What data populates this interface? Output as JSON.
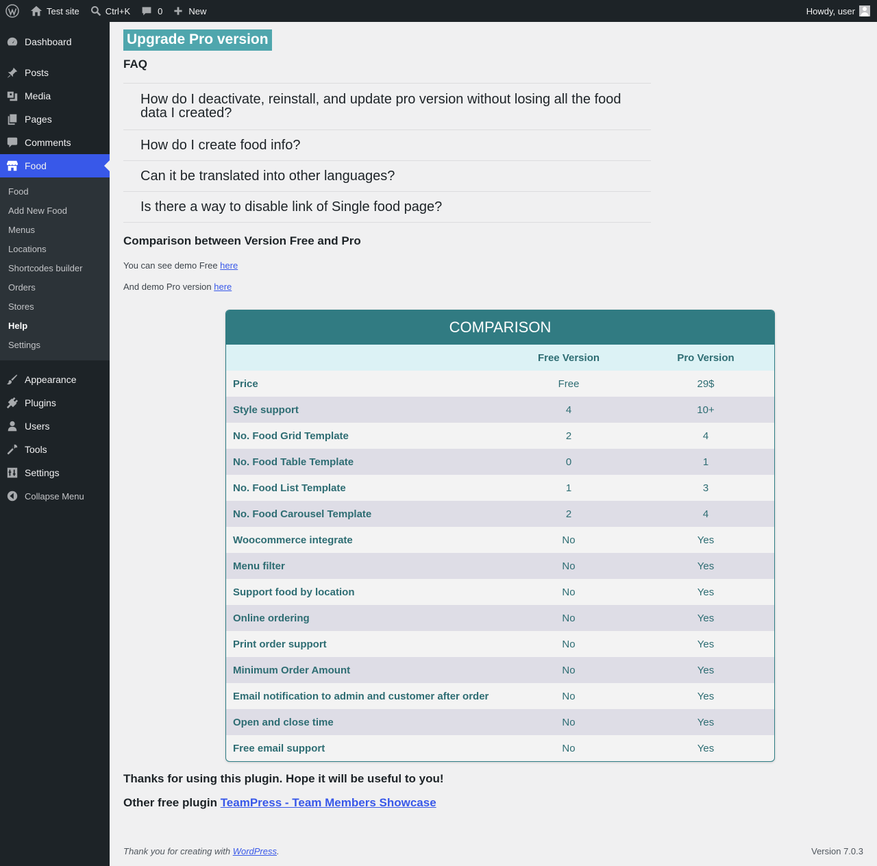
{
  "adminbar": {
    "site_name": "Test site",
    "search_shortcut": "Ctrl+K",
    "comments_count": "0",
    "new_label": "New",
    "howdy": "Howdy, user"
  },
  "sidebar": {
    "items_top": [
      {
        "label": "Dashboard",
        "icon": "dashboard-icon"
      },
      {
        "label": "Posts",
        "icon": "pin-icon"
      },
      {
        "label": "Media",
        "icon": "media-icon"
      },
      {
        "label": "Pages",
        "icon": "pages-icon"
      },
      {
        "label": "Comments",
        "icon": "comment-icon"
      },
      {
        "label": "Food",
        "icon": "store-icon"
      }
    ],
    "submenu": [
      "Food",
      "Add New Food",
      "Menus",
      "Locations",
      "Shortcodes builder",
      "Orders",
      "Stores",
      "Help",
      "Settings"
    ],
    "submenu_active": "Help",
    "items_bottom": [
      {
        "label": "Appearance",
        "icon": "brush-icon"
      },
      {
        "label": "Plugins",
        "icon": "plug-icon"
      },
      {
        "label": "Users",
        "icon": "user-icon"
      },
      {
        "label": "Tools",
        "icon": "wrench-icon"
      },
      {
        "label": "Settings",
        "icon": "settings-icon"
      }
    ],
    "collapse_label": "Collapse Menu"
  },
  "main": {
    "upgrade_title": "Upgrade Pro version",
    "faq_heading": "FAQ",
    "faq_items": [
      "How do I deactivate, reinstall, and update pro version without losing all the food data I created?",
      "How do I create food info?",
      "Can it be translated into other languages?",
      "Is there a way to disable link of Single food page?"
    ],
    "comparison_heading": "Comparison between Version Free and Pro",
    "demo_free_text": "You can see demo Free ",
    "demo_free_link": "here",
    "demo_pro_text": "And demo Pro version ",
    "demo_pro_link": "here",
    "table": {
      "title": "COMPARISON",
      "col_free": "Free Version",
      "col_pro": "Pro Version",
      "rows": [
        [
          "Price",
          "Free",
          "29$"
        ],
        [
          "Style support",
          "4",
          "10+"
        ],
        [
          "No. Food Grid Template",
          "2",
          "4"
        ],
        [
          "No. Food Table Template",
          "0",
          "1"
        ],
        [
          "No. Food List Template",
          "1",
          "3"
        ],
        [
          "No. Food Carousel Template",
          "2",
          "4"
        ],
        [
          "Woocommerce integrate",
          "No",
          "Yes"
        ],
        [
          "Menu filter",
          "No",
          "Yes"
        ],
        [
          "Support food by location",
          "No",
          "Yes"
        ],
        [
          "Online ordering",
          "No",
          "Yes"
        ],
        [
          "Print order support",
          "No",
          "Yes"
        ],
        [
          "Minimum Order Amount",
          "No",
          "Yes"
        ],
        [
          "Email notification to admin and customer after order",
          "No",
          "Yes"
        ],
        [
          "Open and close time",
          "No",
          "Yes"
        ],
        [
          "Free email support",
          "No",
          "Yes"
        ]
      ]
    },
    "thanks": "Thanks for using this plugin. Hope it will be useful to you!",
    "other_text": "Other free plugin ",
    "other_link": "TeamPress - Team Members Showcase"
  },
  "footer": {
    "thanks_text": "Thank you for creating with ",
    "wp_link": "WordPress",
    "period": ".",
    "version": "Version 7.0.3"
  },
  "colors": {
    "accent": "#3858e9",
    "table_header": "#317b82",
    "upgrade_bg": "#4fa6ad"
  }
}
